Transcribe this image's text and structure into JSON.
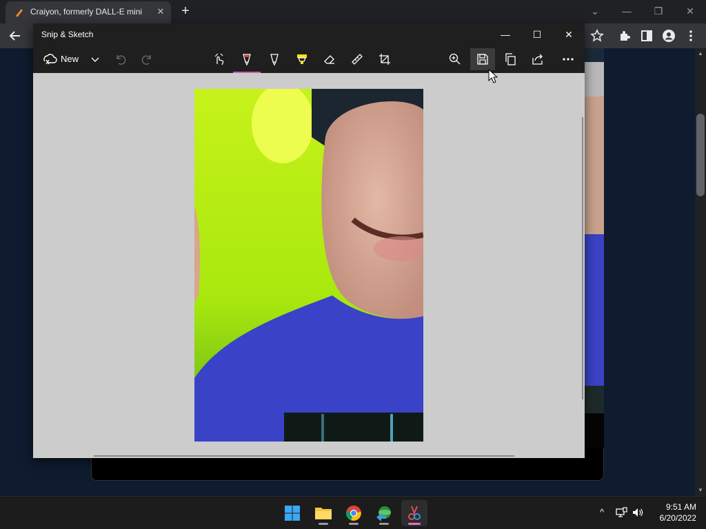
{
  "browser": {
    "tab_title": "Craiyon, formerly DALL-E mini",
    "tab_close_glyph": "✕",
    "new_tab_glyph": "+",
    "minimize_glyph": "—",
    "restore_glyph": "❐",
    "close_glyph": "✕",
    "tab_collapse_glyph": "⌄",
    "icons": [
      "back-icon",
      "star-icon",
      "extensions-icon",
      "sidebar-icon",
      "profile-icon",
      "menu-icon"
    ]
  },
  "snip": {
    "title": "Snip & Sketch",
    "minimize_glyph": "—",
    "maximize_glyph": "☐",
    "close_glyph": "✕",
    "new_label": "New",
    "tools": [
      "touch-writing",
      "ballpoint-pen",
      "pencil",
      "highlighter",
      "eraser",
      "ruler",
      "crop"
    ],
    "actions": [
      "zoom",
      "save",
      "copy",
      "share",
      "see-more"
    ],
    "active_pen_color": "#c75fb6",
    "hovered_action": "save"
  },
  "taskbar": {
    "apps": [
      "start",
      "file-explorer",
      "chrome",
      "app-install",
      "snip-sketch"
    ],
    "active_app": "snip-sketch",
    "tray_chevron": "^",
    "time": "9:51 AM",
    "date": "6/20/2022"
  },
  "colors": {
    "accent": "#c75fb6",
    "titlebar": "#1f1f1f",
    "canvas": "#cccccc"
  }
}
